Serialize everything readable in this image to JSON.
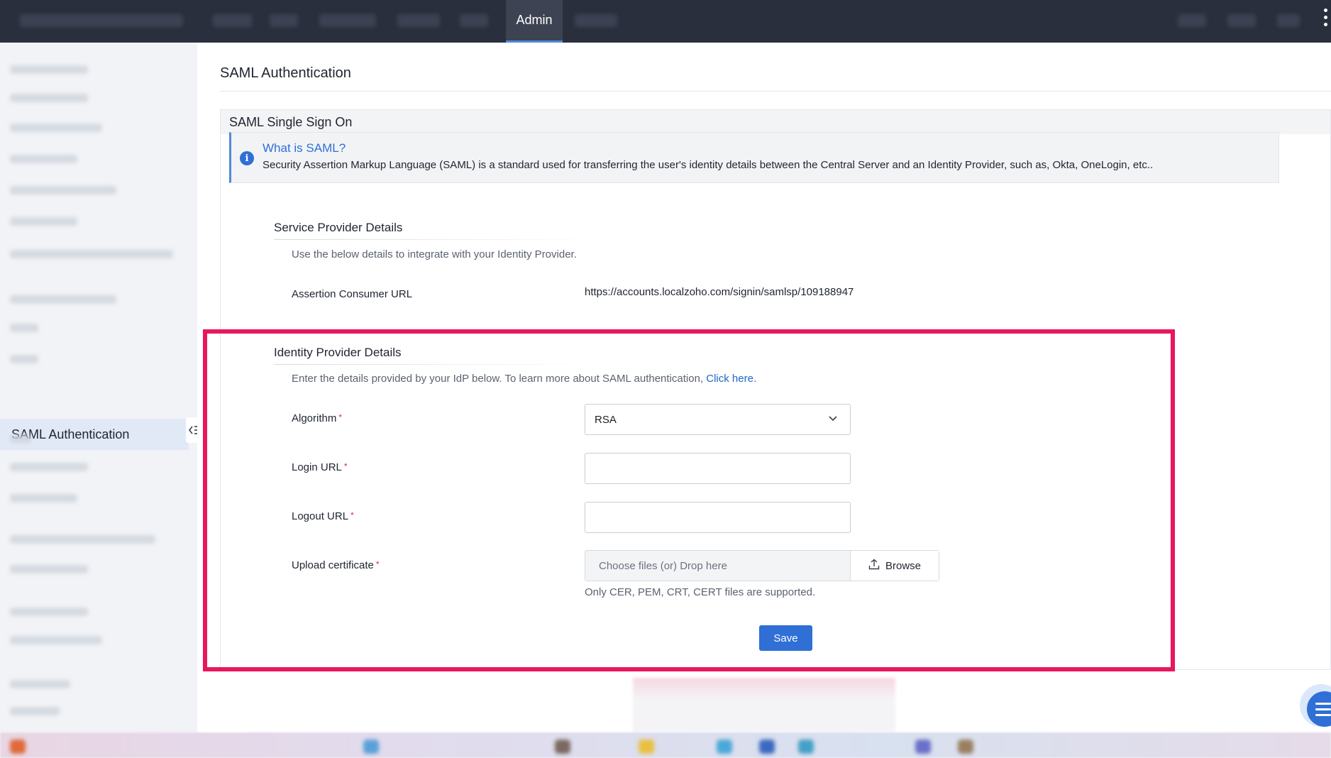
{
  "topbar": {
    "active_tab": "Admin",
    "more_icon": "vertical-dots-icon"
  },
  "sidebar": {
    "active_item": "SAML Authentication",
    "collapse_icon": "collapse-sidebar-icon"
  },
  "page": {
    "title": "SAML Authentication"
  },
  "panel": {
    "heading": "SAML Single Sign On",
    "info": {
      "icon": "info-icon",
      "title": "What is SAML?",
      "text": "Security Assertion Markup Language (SAML) is a standard used for transferring the user's identity details between the Central Server and an Identity Provider, such as, Okta, OneLogin, etc.."
    },
    "service_provider": {
      "title": "Service Provider Details",
      "description": "Use the below details to integrate with your Identity Provider.",
      "acs_label": "Assertion Consumer URL",
      "acs_value": "https://accounts.localzoho.com/signin/samlsp/109188947"
    },
    "identity_provider": {
      "title": "Identity Provider Details",
      "description": "Enter the details provided by your IdP below. To learn more about SAML authentication,",
      "link": "Click here",
      "link_suffix": ".",
      "algorithm_label": "Algorithm",
      "algorithm_value": "RSA",
      "login_url_label": "Login URL",
      "login_url_value": "",
      "logout_url_label": "Logout URL",
      "logout_url_value": "",
      "certificate_label": "Upload certificate",
      "dropzone_text": "Choose files (or) Drop here",
      "browse_label": "Browse",
      "file_hint": "Only CER, PEM, CRT, CERT files are supported.",
      "required_mark": "*",
      "save_label": "Save"
    }
  },
  "colors": {
    "accent": "#2f6fd6",
    "highlight": "#e8175d",
    "topbar": "#2a2f3d"
  }
}
